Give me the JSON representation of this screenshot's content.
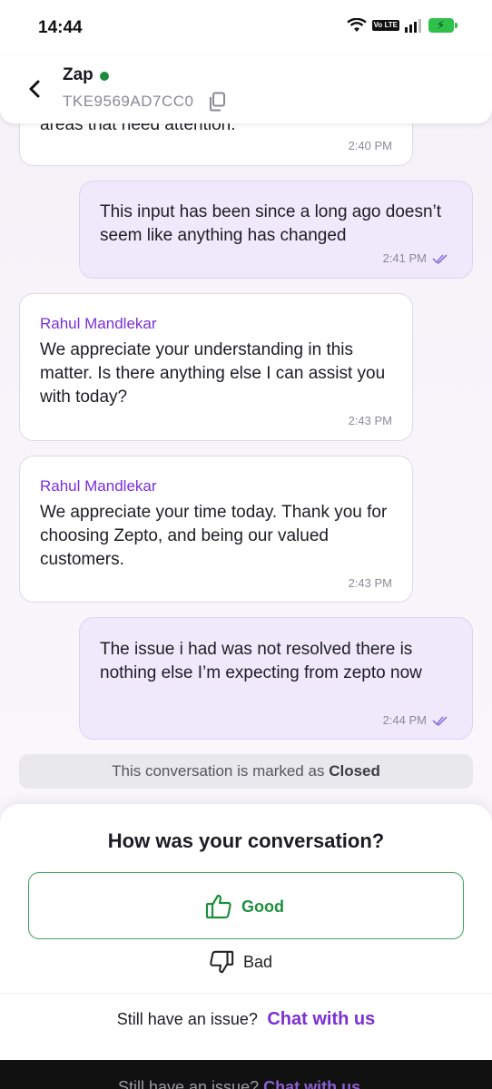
{
  "status_bar": {
    "time": "14:44",
    "network_badge": "Vo LTE"
  },
  "header": {
    "name": "Zap",
    "ticket_id": "TKE9569AD7CC0",
    "online_color": "#1f8a3b"
  },
  "messages": [
    {
      "type": "incoming",
      "text": "areas that need attention.",
      "time": "2:40 PM"
    },
    {
      "type": "outgoing",
      "text": "This input has been since a long ago doesn’t seem like anything has changed",
      "time": "2:41 PM"
    },
    {
      "type": "incoming",
      "sender": "Rahul Mandlekar",
      "text": "We appreciate your understanding in this matter. Is there anything else I can assist you with today?",
      "time": "2:43 PM"
    },
    {
      "type": "incoming",
      "sender": "Rahul Mandlekar",
      "text": "We appreciate your time today. Thank you for choosing Zepto, and being our valued customers.",
      "time": "2:43 PM"
    },
    {
      "type": "outgoing",
      "text": "The issue i had was not resolved there is nothing else I’m expecting from zepto now",
      "time": "2:44 PM"
    }
  ],
  "closed_notice": {
    "prefix": "This conversation is marked as",
    "status": "Closed"
  },
  "feedback": {
    "title": "How was your conversation?",
    "good_label": "Good",
    "bad_label": "Bad"
  },
  "footer": {
    "question": "Still have an issue?",
    "link": "Chat with us"
  },
  "colors": {
    "accent": "#7b2fd6",
    "good": "#1e8f3f",
    "outgoing_bubble": "#efe9fb"
  }
}
